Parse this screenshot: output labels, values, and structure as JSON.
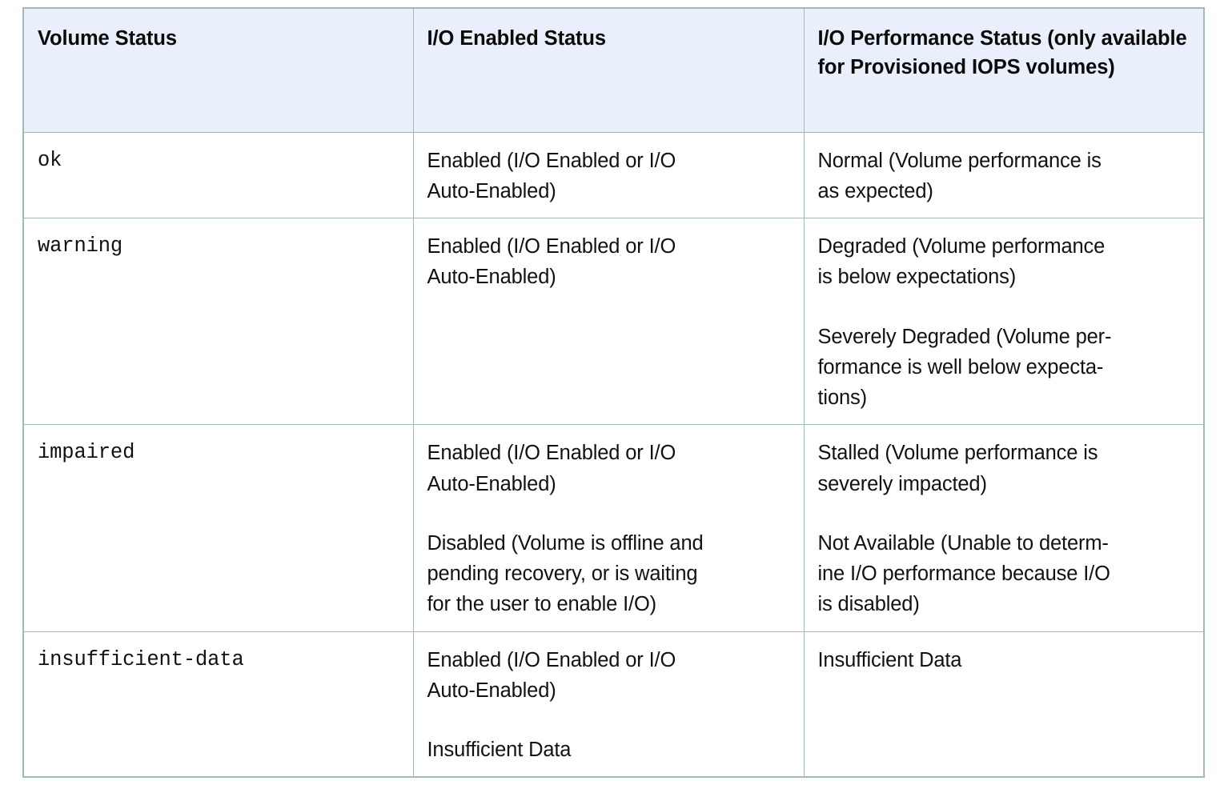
{
  "table": {
    "columns": [
      "Volume Status",
      "I/O Enabled Status",
      "I/O Performance Status (only available for Provisioned IOPS volumes)"
    ],
    "colors": {
      "header_background": "#e9f0fb",
      "border": "#a6b7ba",
      "cell_background": "#ffffff",
      "text": "#111111"
    },
    "rows": [
      {
        "volume_status": "ok",
        "io_enabled_status": [
          "Enabled (I/O Enabled or I/O\nAuto-Enabled)"
        ],
        "io_performance_status": [
          "Normal (Volume performance is\nas expected)"
        ]
      },
      {
        "volume_status": "warning",
        "io_enabled_status": [
          "Enabled (I/O Enabled or I/O\nAuto-Enabled)"
        ],
        "io_performance_status": [
          "Degraded (Volume performance\nis below expectations)",
          "Severely Degraded (Volume per-\nformance is well below expecta-\ntions)"
        ]
      },
      {
        "volume_status": "impaired",
        "io_enabled_status": [
          "Enabled (I/O Enabled or I/O\nAuto-Enabled)",
          "Disabled (Volume is offline and\npending recovery, or is waiting\nfor the user to enable I/O)"
        ],
        "io_performance_status": [
          "Stalled (Volume performance is\nseverely impacted)",
          "Not Available (Unable to determ-\nine I/O performance because I/O\nis disabled)"
        ]
      },
      {
        "volume_status": "insufficient-data",
        "io_enabled_status": [
          "Enabled (I/O Enabled or I/O\nAuto-Enabled)",
          "Insufficient Data"
        ],
        "io_performance_status": [
          "Insufficient Data"
        ]
      }
    ]
  }
}
